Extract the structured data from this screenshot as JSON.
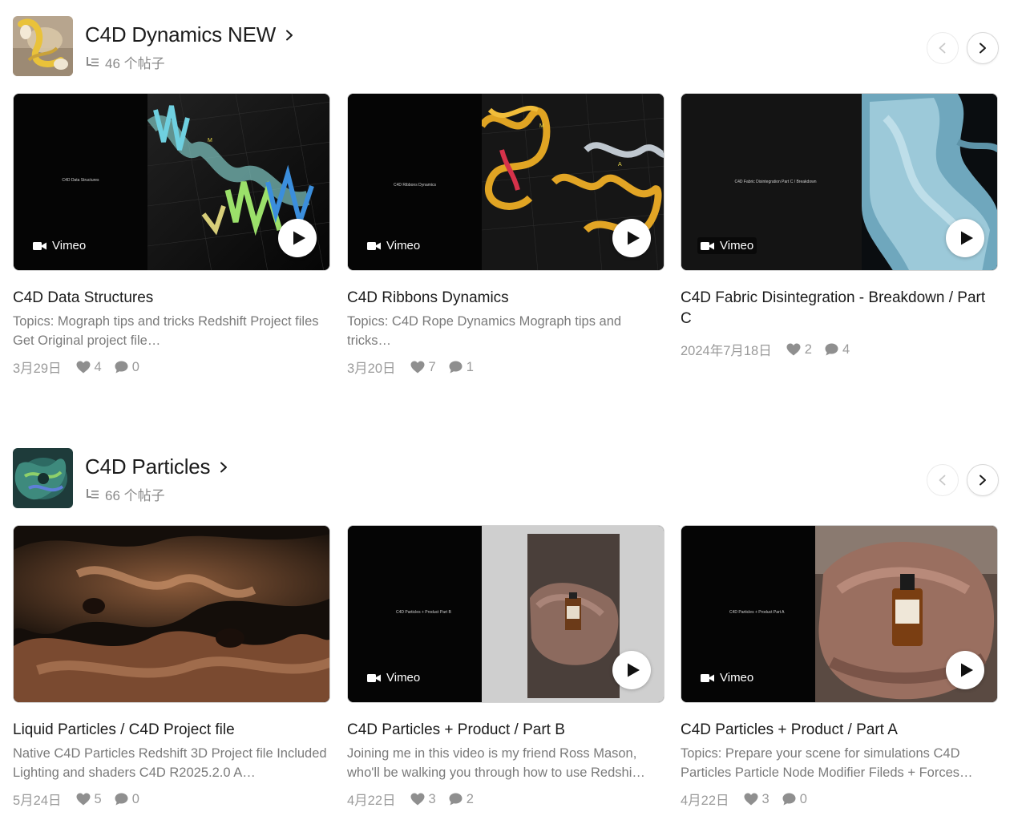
{
  "colors": {
    "title": "#1c1c1c",
    "muted": "#7a7a7a",
    "meta": "#9a9a9a"
  },
  "collections": [
    {
      "title": "C4D Dynamics NEW",
      "post_count": "46 个帖子",
      "posts": [
        {
          "title": "C4D Data Structures",
          "description": "Topics: Mograph tips and tricks Redshift Project files Get Original project file…",
          "slide_text": "C4D Data Structures",
          "video_badge": "Vimeo",
          "date": "3月29日",
          "likes": "4",
          "comments": "0"
        },
        {
          "title": "C4D Ribbons Dynamics",
          "description": "Topics: C4D Rope Dynamics Mograph tips and tricks…",
          "slide_text": "C4D Ribbons Dynamics",
          "video_badge": "Vimeo",
          "date": "3月20日",
          "likes": "7",
          "comments": "1"
        },
        {
          "title": "C4D Fabric Disintegration - Breakdown / Part C",
          "description": "",
          "slide_text": "C4D Fabric Disintegration Part C / Breakdown",
          "video_badge": "Vimeo",
          "date": "2024年7月18日",
          "likes": "2",
          "comments": "4"
        }
      ]
    },
    {
      "title": "C4D Particles",
      "post_count": "66 个帖子",
      "posts": [
        {
          "title": "Liquid Particles / C4D Project file",
          "description": "Native C4D Particles Redshift 3D Project file Included Lighting and shaders C4D R2025.2.0 A…",
          "date": "5月24日",
          "likes": "5",
          "comments": "0"
        },
        {
          "title": "C4D Particles + Product / Part B",
          "description": "Joining me in this video is my friend Ross Mason, who'll be walking you through how to use Redshi…",
          "slide_text": "C4D Particles + Product Part B",
          "video_badge": "Vimeo",
          "date": "4月22日",
          "likes": "3",
          "comments": "2"
        },
        {
          "title": "C4D Particles + Product / Part A",
          "description": "Topics: Prepare your scene for simulations C4D Particles Particle Node Modifier Fileds + Forces…",
          "slide_text": "C4D Particles + Product Part A",
          "video_badge": "Vimeo",
          "date": "4月22日",
          "likes": "3",
          "comments": "0"
        }
      ]
    }
  ]
}
